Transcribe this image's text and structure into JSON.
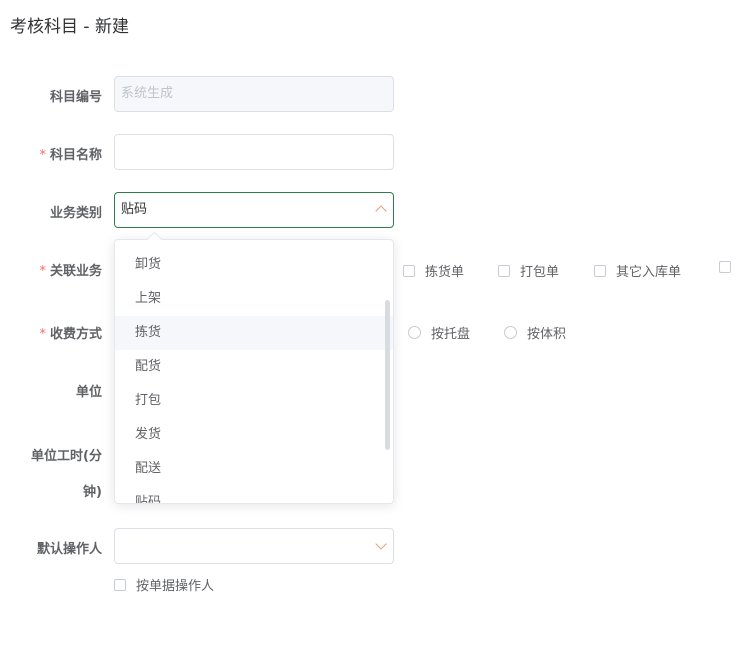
{
  "page": {
    "title": "考核科目 - 新建"
  },
  "form": {
    "subject_code": {
      "label": "科目编号",
      "placeholder": "系统生成"
    },
    "subject_name": {
      "required": "*",
      "label": "科目名称",
      "value": ""
    },
    "business_type": {
      "label": "业务类别",
      "value": "贴码"
    },
    "related_business": {
      "required": "*",
      "label": "关联业务",
      "options": [
        "拣货单",
        "打包单",
        "其它入库单"
      ]
    },
    "charge_method": {
      "required": "*",
      "label": "收费方式",
      "options": [
        "按托盘",
        "按体积"
      ]
    },
    "unit": {
      "label": "单位"
    },
    "unit_hours": {
      "label_line1": "单位工时(分",
      "label_line2": "钟)"
    },
    "default_operator": {
      "label": "默认操作人",
      "value": ""
    },
    "by_document_operator": {
      "label": "按单据操作人"
    }
  },
  "dropdown": {
    "options": [
      "卸货",
      "上架",
      "拣货",
      "配货",
      "打包",
      "发货",
      "配送",
      "贴码"
    ],
    "hovered": "拣货"
  }
}
